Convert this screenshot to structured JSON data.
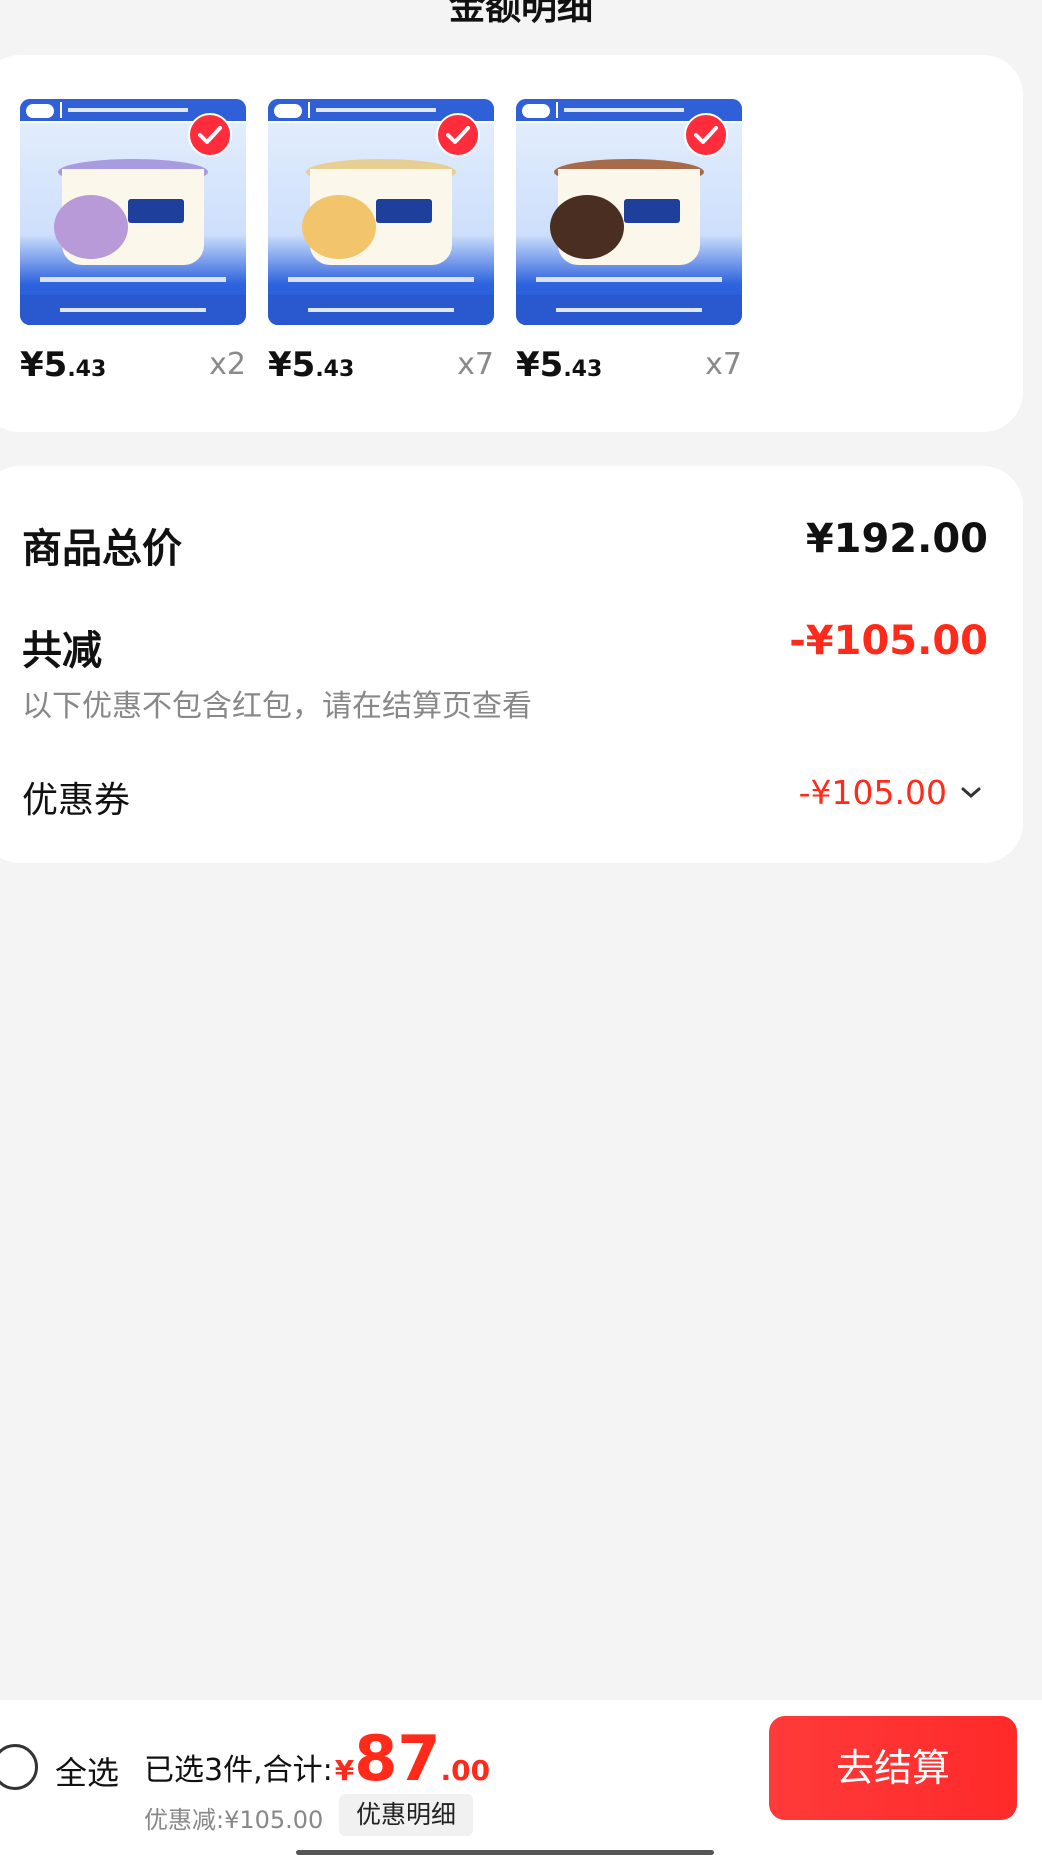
{
  "modal": {
    "title": "金额明细"
  },
  "products": [
    {
      "price_int": "¥5",
      "price_dec": ".43",
      "qty": "x2",
      "scoop_color": "#b89ad8",
      "lid_color": "#a99be0"
    },
    {
      "price_int": "¥5",
      "price_dec": ".43",
      "qty": "x7",
      "scoop_color": "#f2c56c",
      "lid_color": "#e7cf94"
    },
    {
      "price_int": "¥5",
      "price_dec": ".43",
      "qty": "x7",
      "scoop_color": "#4a2e22",
      "lid_color": "#a86a48"
    }
  ],
  "summary": {
    "goods_total_label": "商品总价",
    "goods_total_value": "¥192.00",
    "reduction_label": "共减",
    "reduction_value": "-¥105.00",
    "reduction_note": "以下优惠不包含红包，请在结算页查看",
    "coupon_label": "优惠券",
    "coupon_value": "-¥105.00"
  },
  "bottom_bar": {
    "select_all_label": "全选",
    "selected_summary": "已选3件,合计:",
    "currency": "¥",
    "total_int": "87",
    "total_dec": ".00",
    "discount_text": "优惠减:¥105.00",
    "detail_button": "优惠明细",
    "checkout_button": "去结算"
  },
  "colors": {
    "accent_red": "#ff2a1a",
    "check_red": "#ff2d3c",
    "product_blue": "#2e63de"
  }
}
